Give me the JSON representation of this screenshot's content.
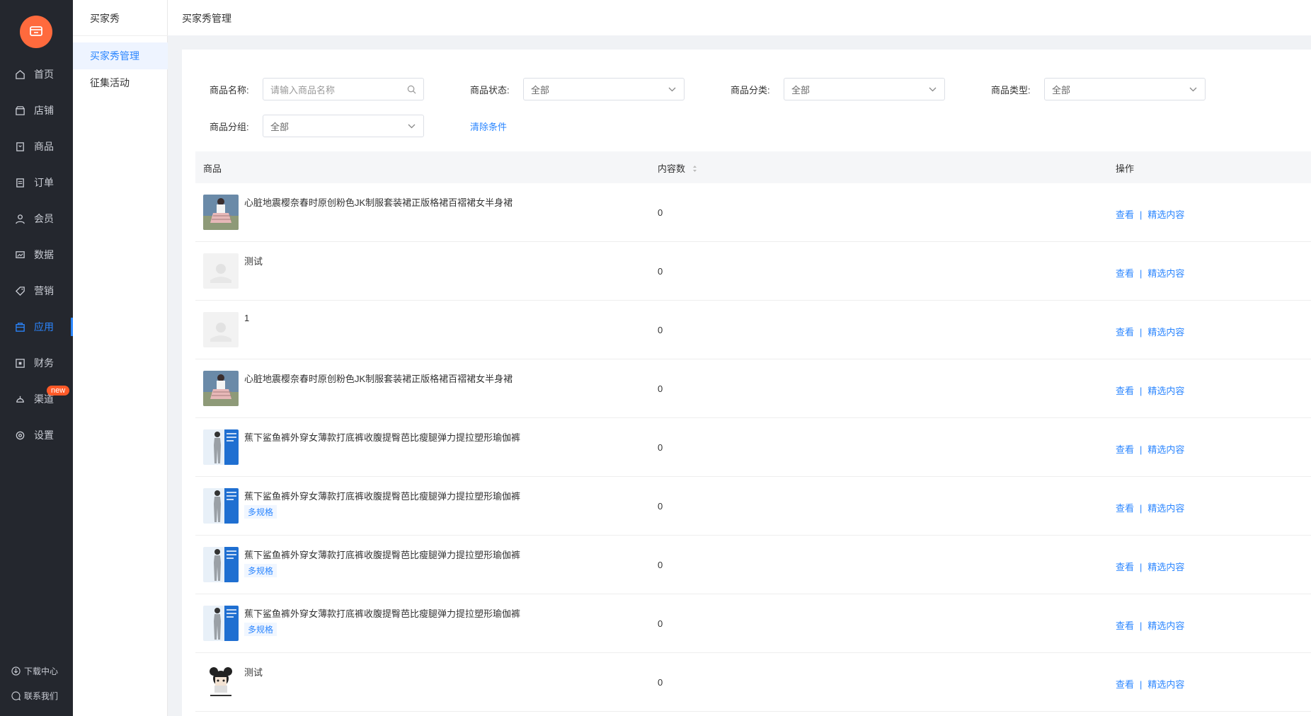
{
  "nav": {
    "items": [
      {
        "label": "首页",
        "icon": "home-icon"
      },
      {
        "label": "店铺",
        "icon": "store-icon"
      },
      {
        "label": "商品",
        "icon": "goods-icon"
      },
      {
        "label": "订单",
        "icon": "order-icon"
      },
      {
        "label": "会员",
        "icon": "user-icon"
      },
      {
        "label": "数据",
        "icon": "chart-icon"
      },
      {
        "label": "营销",
        "icon": "tag-icon"
      },
      {
        "label": "应用",
        "icon": "app-icon"
      },
      {
        "label": "财务",
        "icon": "finance-icon"
      },
      {
        "label": "渠道",
        "icon": "channel-icon",
        "badge": "new"
      },
      {
        "label": "设置",
        "icon": "gear-icon"
      }
    ],
    "active_label": "应用",
    "footer": {
      "download": "下载中心",
      "contact": "联系我们"
    }
  },
  "subnav": {
    "title": "买家秀",
    "items": [
      "买家秀管理",
      "征集活动"
    ]
  },
  "header": {
    "title": "买家秀管理"
  },
  "filters": {
    "name_label": "商品名称:",
    "name_placeholder": "请输入商品名称",
    "status_label": "商品状态:",
    "status_value": "全部",
    "category_label": "商品分类:",
    "category_value": "全部",
    "type_label": "商品类型:",
    "type_value": "全部",
    "group_label": "商品分组:",
    "group_value": "全部",
    "clear": "清除条件"
  },
  "table": {
    "columns": [
      "商品",
      "内容数",
      "操作"
    ],
    "actions": {
      "view": "查看",
      "sep": "|",
      "featured": "精选内容"
    },
    "rows": [
      {
        "name": "心脏地震樱奈春时原创粉色JK制服套装裙正版格裙百褶裙女半身裙",
        "tag": "",
        "count": "0",
        "thumb": "skirt"
      },
      {
        "name": "测试",
        "tag": "",
        "count": "0",
        "thumb": "placeholder"
      },
      {
        "name": "1",
        "tag": "",
        "count": "0",
        "thumb": "placeholder"
      },
      {
        "name": "心脏地震樱奈春时原创粉色JK制服套装裙正版格裙百褶裙女半身裙",
        "tag": "",
        "count": "0",
        "thumb": "skirt"
      },
      {
        "name": "蕉下鲨鱼裤外穿女薄款打底裤收腹提臀芭比瘦腿弹力提拉塑形瑜伽裤",
        "tag": "",
        "count": "0",
        "thumb": "leggings"
      },
      {
        "name": "蕉下鲨鱼裤外穿女薄款打底裤收腹提臀芭比瘦腿弹力提拉塑形瑜伽裤",
        "tag": "多规格",
        "count": "0",
        "thumb": "leggings"
      },
      {
        "name": "蕉下鲨鱼裤外穿女薄款打底裤收腹提臀芭比瘦腿弹力提拉塑形瑜伽裤",
        "tag": "多规格",
        "count": "0",
        "thumb": "leggings"
      },
      {
        "name": "蕉下鲨鱼裤外穿女薄款打底裤收腹提臀芭比瘦腿弹力提拉塑形瑜伽裤",
        "tag": "多规格",
        "count": "0",
        "thumb": "leggings"
      },
      {
        "name": "测试",
        "tag": "",
        "count": "0",
        "thumb": "cartoon"
      }
    ]
  },
  "colors": {
    "accent": "#2b86ff",
    "nav_bg": "#24272e",
    "logo": "#ff6a3d",
    "badge": "#ff5a28"
  }
}
